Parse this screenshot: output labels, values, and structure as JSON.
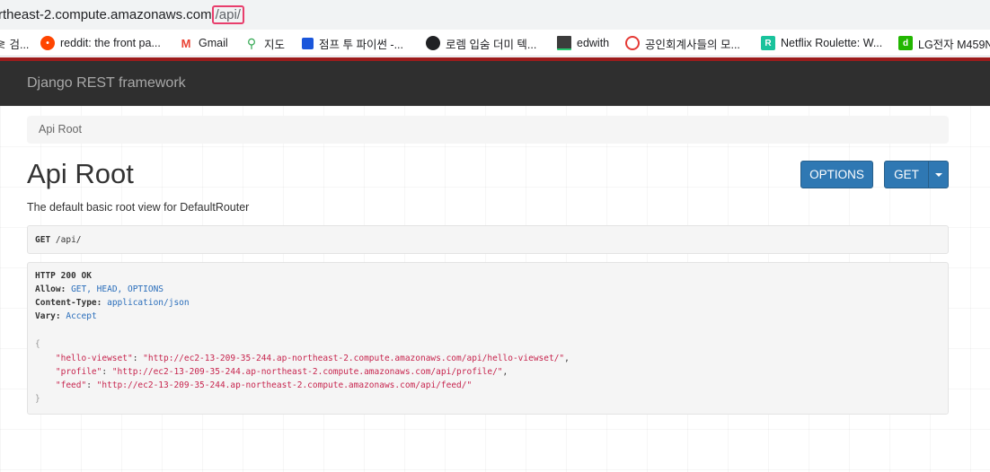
{
  "browser": {
    "url_prefix": "rtheast-2.compute.amazonaws.com",
    "url_highlight": "/api/"
  },
  "bookmarks": [
    {
      "label": "검...",
      "icon": "korean-search-icon",
      "prefix": "≷"
    },
    {
      "label": "reddit: the front pa...",
      "icon": "reddit-icon",
      "color": "#ff4500"
    },
    {
      "label": "Gmail",
      "icon": "gmail-icon",
      "color": "#ea4335"
    },
    {
      "label": "지도",
      "icon": "maps-pin-icon",
      "color": "#34a853"
    },
    {
      "label": "점프 투 파이썬 -...",
      "icon": "wikidocs-icon",
      "color": "#1a56db"
    },
    {
      "label": "로렘 입숨 더미 텍...",
      "icon": "globe-icon",
      "color": "#202124"
    },
    {
      "label": "edwith",
      "icon": "edwith-icon",
      "color": "#3c3c3c"
    },
    {
      "label": "공인회계사들의 모...",
      "icon": "cpa-icon",
      "color": "#e53935"
    },
    {
      "label": "Netflix Roulette: W...",
      "icon": "netflix-roulette-icon",
      "color": "#19c39c"
    },
    {
      "label": "LG전자 M459N",
      "icon": "lg-d-icon",
      "color": "#22b600"
    }
  ],
  "navbar": {
    "brand": "Django REST framework",
    "accent": "#9b1c1c"
  },
  "breadcrumb": {
    "label": "Api Root"
  },
  "page": {
    "title": "Api Root",
    "description": "The default basic root view for DefaultRouter"
  },
  "buttons": {
    "options_label": "OPTIONS",
    "get_label": "GET",
    "color": "#2f78b3"
  },
  "request": {
    "method": "GET",
    "path": "/api/"
  },
  "response": {
    "status_line": "HTTP 200 OK",
    "headers": [
      {
        "name": "Allow:",
        "value": "GET, HEAD, OPTIONS"
      },
      {
        "name": "Content-Type:",
        "value": "application/json"
      },
      {
        "name": "Vary:",
        "value": "Accept"
      }
    ],
    "open_brace": "{",
    "close_brace": "}",
    "body": [
      {
        "key": "\"hello-viewset\"",
        "value": "\"http://ec2-13-209-35-244.ap-northeast-2.compute.amazonaws.com/api/hello-viewset/\"",
        "comma": ","
      },
      {
        "key": "\"profile\"",
        "value": "\"http://ec2-13-209-35-244.ap-northeast-2.compute.amazonaws.com/api/profile/\"",
        "comma": ","
      },
      {
        "key": "\"feed\"",
        "value": "\"http://ec2-13-209-35-244.ap-northeast-2.compute.amazonaws.com/api/feed/\"",
        "comma": ""
      }
    ]
  }
}
